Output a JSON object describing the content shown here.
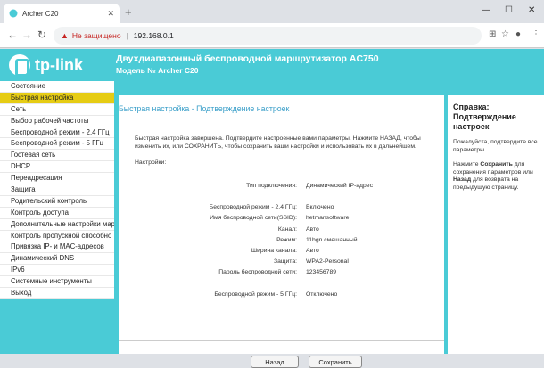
{
  "browser": {
    "tab_title": "Archer C20",
    "not_secure": "Не защищено",
    "url": "192.168.0.1"
  },
  "header": {
    "logo_text": "tp-link",
    "router_title": "Двухдиапазонный беспроводной маршрутизатор AC750",
    "router_model": "Модель № Archer C20"
  },
  "sidebar": {
    "items": [
      {
        "label": "Состояние"
      },
      {
        "label": "Быстрая настройка"
      },
      {
        "label": "Сеть"
      },
      {
        "label": "Выбор рабочей частоты"
      },
      {
        "label": "Беспроводной режим - 2,4 ГГц"
      },
      {
        "label": "Беспроводной режим - 5 ГГц"
      },
      {
        "label": "Гостевая сеть"
      },
      {
        "label": "DHCP"
      },
      {
        "label": "Переадресация"
      },
      {
        "label": "Защита"
      },
      {
        "label": "Родительский контроль"
      },
      {
        "label": "Контроль доступа"
      },
      {
        "label": "Дополнительные настройки мар"
      },
      {
        "label": "Контроль пропускной способно"
      },
      {
        "label": "Привязка IP- и MAC-адресов"
      },
      {
        "label": "Динамический DNS"
      },
      {
        "label": "IPv6"
      },
      {
        "label": "Системные инструменты"
      },
      {
        "label": "Выход"
      }
    ],
    "active_index": 1
  },
  "main": {
    "title": "Быстрая настройка - Подтверждение настроек",
    "intro": "Быстрая настройка завершена. Подтвердите настроенные вами параметры. Нажмите НАЗАД, чтобы изменить их, или СОХРАНИТЬ, чтобы сохранить ваши настройки и использовать их в дальнейшем.",
    "settings_label": "Настройки:",
    "rows": [
      {
        "label": "Тип подключения:",
        "value": "Динамический IP-адрес"
      },
      {
        "label": "Беспроводной режим - 2,4 ГГц:",
        "value": "Включено"
      },
      {
        "label": "Имя беспроводной сети(SSID):",
        "value": "hetmansoftware"
      },
      {
        "label": "Канал:",
        "value": "Авто"
      },
      {
        "label": "Режим:",
        "value": "11bgn смешанный"
      },
      {
        "label": "Ширина канала:",
        "value": "Авто"
      },
      {
        "label": "Защита:",
        "value": "WPA2-Personal"
      },
      {
        "label": "Пароль беспроводной сети:",
        "value": "123456789"
      },
      {
        "label": "Беспроводной режим - 5 ГГц:",
        "value": "Отключено"
      }
    ],
    "back_button": "Назад",
    "save_button": "Сохранить"
  },
  "help": {
    "title": "Справка: Подтверждение настроек",
    "p1": "Пожалуйста, подтвердите все параметры.",
    "p2_pre": "Нажмите ",
    "p2_save": "Сохранить",
    "p2_mid": " для сохранения параметров или ",
    "p2_back": "Назад",
    "p2_post": " для возврата на предыдущую страницу."
  },
  "colors": {
    "accent": "#4acbd6",
    "active_menu": "#e6cc14",
    "title_blue": "#3a9fc9"
  }
}
